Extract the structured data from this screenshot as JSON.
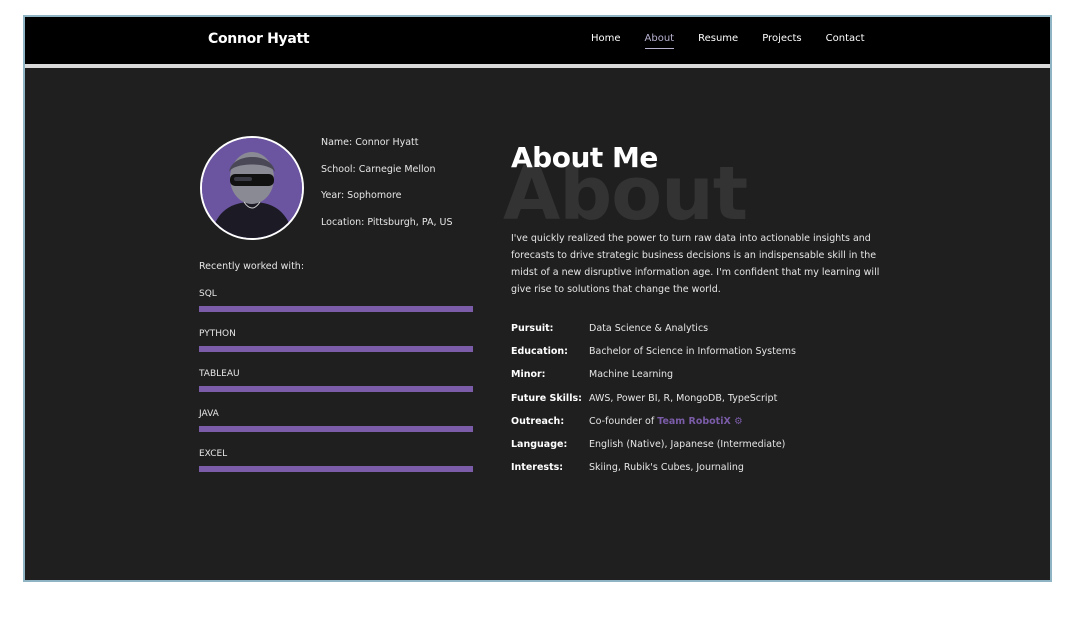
{
  "header": {
    "brand": "Connor Hyatt",
    "nav": [
      "Home",
      "About",
      "Resume",
      "Projects",
      "Contact"
    ],
    "active_nav": "About"
  },
  "profile": {
    "name": "Name: Connor Hyatt",
    "school": "School: Carnegie Mellon",
    "year": "Year: Sophomore",
    "location": "Location: Pittsburgh, PA, US"
  },
  "skills": {
    "title": "Recently worked with:",
    "items": [
      {
        "name": "SQL",
        "level": 1.0
      },
      {
        "name": "PYTHON",
        "level": 1.0
      },
      {
        "name": "TABLEAU",
        "level": 1.0
      },
      {
        "name": "JAVA",
        "level": 1.0
      },
      {
        "name": "EXCEL",
        "level": 1.0
      }
    ]
  },
  "about": {
    "watermark": "About",
    "heading": "About Me",
    "bio": "I've quickly realized the power to turn raw data into actionable insights and forecasts to drive strategic business decisions is an indispensable skill in the midst of a new disruptive information age. I'm confident that my learning will give rise to solutions that change the world.",
    "details": [
      {
        "key": "Pursuit:",
        "value": "Data Science & Analytics"
      },
      {
        "key": "Education:",
        "value": "Bachelor of Science in Information Systems"
      },
      {
        "key": "Minor:",
        "value": "Machine Learning"
      },
      {
        "key": "Future Skills:",
        "value": "AWS, Power BI, R, MongoDB, TypeScript"
      },
      {
        "key": "Outreach:",
        "value": "Co-founder of ",
        "link": "Team RobotiX ⚙"
      },
      {
        "key": "Language:",
        "value": "English (Native), Japanese (Intermediate)"
      },
      {
        "key": "Interests:",
        "value": "Skiing, Rubik's Cubes, Journaling"
      }
    ]
  },
  "colors": {
    "accent": "#7a5ca8",
    "background": "#1f1f1f"
  }
}
